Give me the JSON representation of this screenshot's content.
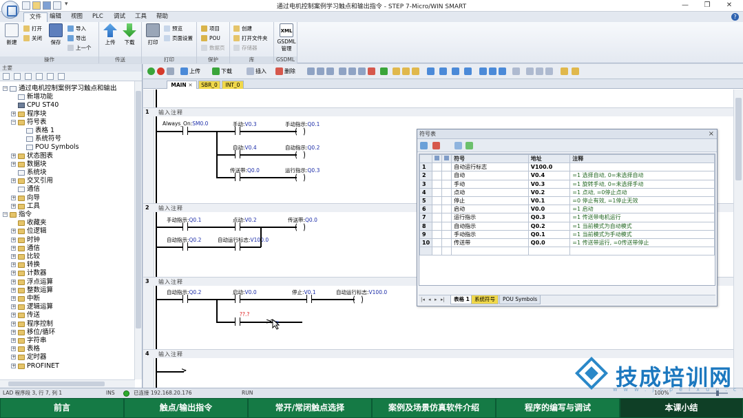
{
  "window": {
    "title": "通过电机控制案例学习触点和输出指令 - STEP 7-Micro/WIN SMART",
    "minimize": "—",
    "restore": "❐",
    "close": "✕"
  },
  "ribbon": {
    "tabs": [
      "文件",
      "编辑",
      "视图",
      "PLC",
      "调试",
      "工具",
      "帮助"
    ],
    "active_tab": "文件",
    "groups": {
      "operation": {
        "label": "操作",
        "new": "新建",
        "open": "打开",
        "close": "关闭",
        "save": "保存",
        "import": "导入",
        "export": "导出",
        "prev": "上一个"
      },
      "transfer": {
        "label": "传送",
        "upload": "上传",
        "download": "下载"
      },
      "print": {
        "label": "打印",
        "print": "打印",
        "preview": "预览",
        "page_setup": "页面设置"
      },
      "protect": {
        "label": "保护",
        "project": "项目",
        "pou": "POU",
        "data_page": "数据页"
      },
      "library": {
        "label": "库",
        "create": "创建",
        "open_folder": "打开文件夹",
        "memory": "存储器"
      },
      "gsdml": {
        "label": "GSDML",
        "manage": "GSDML 管理",
        "icon_text": "XML"
      }
    }
  },
  "tree": {
    "header": "主要",
    "items": [
      {
        "label": "通过电机控制案例学习触点和输出",
        "exp": "−"
      },
      {
        "label": "新增功能",
        "exp": ""
      },
      {
        "label": "CPU ST40",
        "exp": ""
      },
      {
        "label": "程序块",
        "exp": "+"
      },
      {
        "label": "符号表",
        "exp": "−"
      },
      {
        "label": "表格 1",
        "exp": ""
      },
      {
        "label": "系统符号",
        "exp": ""
      },
      {
        "label": "POU Symbols",
        "exp": ""
      },
      {
        "label": "状态图表",
        "exp": "+"
      },
      {
        "label": "数据块",
        "exp": "+"
      },
      {
        "label": "系统块",
        "exp": ""
      },
      {
        "label": "交叉引用",
        "exp": "+"
      },
      {
        "label": "通信",
        "exp": ""
      },
      {
        "label": "向导",
        "exp": "+"
      },
      {
        "label": "工具",
        "exp": "+"
      },
      {
        "label": "指令",
        "exp": "−"
      },
      {
        "label": "收藏夹",
        "exp": ""
      },
      {
        "label": "位逻辑",
        "exp": "+"
      },
      {
        "label": "时钟",
        "exp": "+"
      },
      {
        "label": "通信",
        "exp": "+"
      },
      {
        "label": "比较",
        "exp": "+"
      },
      {
        "label": "转换",
        "exp": "+"
      },
      {
        "label": "计数器",
        "exp": "+"
      },
      {
        "label": "浮点运算",
        "exp": "+"
      },
      {
        "label": "整数运算",
        "exp": "+"
      },
      {
        "label": "中断",
        "exp": "+"
      },
      {
        "label": "逻辑运算",
        "exp": "+"
      },
      {
        "label": "传送",
        "exp": "+"
      },
      {
        "label": "程序控制",
        "exp": "+"
      },
      {
        "label": "移位/循环",
        "exp": "+"
      },
      {
        "label": "字符串",
        "exp": "+"
      },
      {
        "label": "表格",
        "exp": "+"
      },
      {
        "label": "定时器",
        "exp": "+"
      },
      {
        "label": "PROFINET",
        "exp": "+"
      }
    ]
  },
  "editor": {
    "toolbar": {
      "upload": "上传",
      "download": "下载",
      "insert": "插入",
      "delete": "删除"
    },
    "tabs": [
      "MAIN",
      "SBR_0",
      "INT_0"
    ],
    "networks": [
      {
        "num": "1",
        "comment": "输入注释",
        "labels": [
          {
            "sym": "Always_On:",
            "addr": "SM0.0"
          },
          {
            "sym": "手动:",
            "addr": "V0.3"
          },
          {
            "sym": "手动指示:",
            "addr": "Q0.1"
          },
          {
            "sym": "自动:",
            "addr": "V0.4"
          },
          {
            "sym": "自动指示:",
            "addr": "Q0.2"
          },
          {
            "sym": "传送带:",
            "addr": "Q0.0"
          },
          {
            "sym": "运行指示:",
            "addr": "Q0.3"
          }
        ]
      },
      {
        "num": "2",
        "comment": "输入注释",
        "labels": [
          {
            "sym": "手动指示:",
            "addr": "Q0.1"
          },
          {
            "sym": "点动:",
            "addr": "V0.2"
          },
          {
            "sym": "传送带:",
            "addr": "Q0.0"
          },
          {
            "sym": "自动指示:",
            "addr": "Q0.2"
          },
          {
            "sym": "自动运行标志:",
            "addr": "V100.0"
          }
        ]
      },
      {
        "num": "3",
        "comment": "输入注释",
        "labels": [
          {
            "sym": "自动指示:",
            "addr": "Q0.2"
          },
          {
            "sym": "启动:",
            "addr": "V0.0"
          },
          {
            "sym": "停止:",
            "addr": "V0.1"
          },
          {
            "sym": "自动运行标志:",
            "addr": "V100.0"
          }
        ],
        "error_label": "??.?"
      },
      {
        "num": "4",
        "comment": "输入注释",
        "labels": []
      }
    ]
  },
  "symbol_table": {
    "title": "符号表",
    "headers": [
      "符号",
      "地址",
      "注释"
    ],
    "rows": [
      {
        "n": "1",
        "symbol": "自动运行标志",
        "address": "V100.0",
        "comment": ""
      },
      {
        "n": "2",
        "symbol": "自动",
        "address": "V0.4",
        "comment": "=1 选择自动, 0=未选择自动"
      },
      {
        "n": "3",
        "symbol": "手动",
        "address": "V0.3",
        "comment": "=1 旋转手动, 0=未选择手动"
      },
      {
        "n": "4",
        "symbol": "点动",
        "address": "V0.2",
        "comment": "=1 点动, =0停止点动"
      },
      {
        "n": "5",
        "symbol": "停止",
        "address": "V0.1",
        "comment": "=0 停止有效, =1停止无效"
      },
      {
        "n": "6",
        "symbol": "启动",
        "address": "V0.0",
        "comment": "=1 启动"
      },
      {
        "n": "7",
        "symbol": "运行指示",
        "address": "Q0.3",
        "comment": "=1 传送带电机运行"
      },
      {
        "n": "8",
        "symbol": "自动指示",
        "address": "Q0.2",
        "comment": "=1 当前模式为自动模式"
      },
      {
        "n": "9",
        "symbol": "手动指示",
        "address": "Q0.1",
        "comment": "=1 当前模式为手动模式"
      },
      {
        "n": "10",
        "symbol": "传送带",
        "address": "Q0.0",
        "comment": "=1 传送带运行, =0传送带停止"
      }
    ],
    "sheet_tabs": [
      "表格 1",
      "系统符号",
      "POU Symbols"
    ]
  },
  "statusbar": {
    "mode": "LAD 程序段 3, 行 7, 列 1",
    "ins": "INS",
    "connection": "已连接 192.168.20.176",
    "run": "RUN",
    "zoom": "100%"
  },
  "course_nav": {
    "items": [
      "前言",
      "触点/输出指令",
      "常开/常闭触点选择",
      "案例及场景仿真软件介绍",
      "程序的编写与调试",
      "本课小结"
    ],
    "active": "本课小结"
  },
  "watermark": {
    "brand": "技成培训网",
    "url": "www.jcpeixun.com"
  },
  "colors": {
    "address_blue": "#1b2ca8",
    "course_green": "#157a45",
    "tab_yellow": "#f0d84a",
    "brand_blue": "#1c78bf"
  }
}
